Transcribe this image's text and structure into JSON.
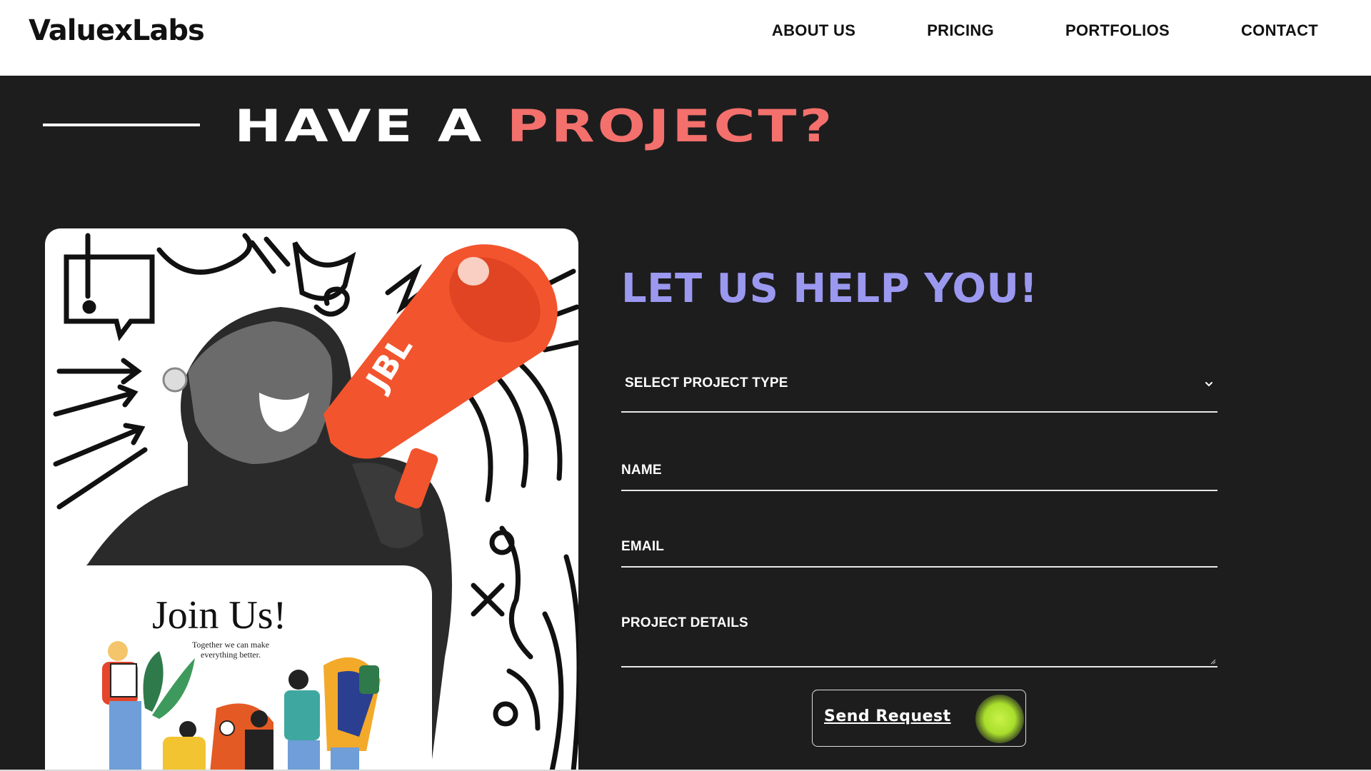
{
  "header": {
    "logo": "ValuexLabs",
    "nav": [
      "ABOUT US",
      "PRICING",
      "PORTFOLIOS",
      "CONTACT"
    ]
  },
  "hero": {
    "heading_white": "HAVE A ",
    "heading_accent": "PROJECT?"
  },
  "card": {
    "join_title": "Join Us!",
    "join_subtitle": "Together we can make everything better."
  },
  "form": {
    "title": "LET US HELP YOU!",
    "select_label": "SELECT PROJECT TYPE",
    "name_label": "NAME",
    "email_label": "EMAIL",
    "details_label": "PROJECT DETAILS",
    "send_label": "Send Request"
  },
  "colors": {
    "accent_coral": "#f4706c",
    "accent_lavender": "#9b98f0",
    "button_glow": "#b6e836",
    "section_bg": "#1d1d1e"
  },
  "icons": {
    "select_chevron": "chevron-down-icon"
  }
}
